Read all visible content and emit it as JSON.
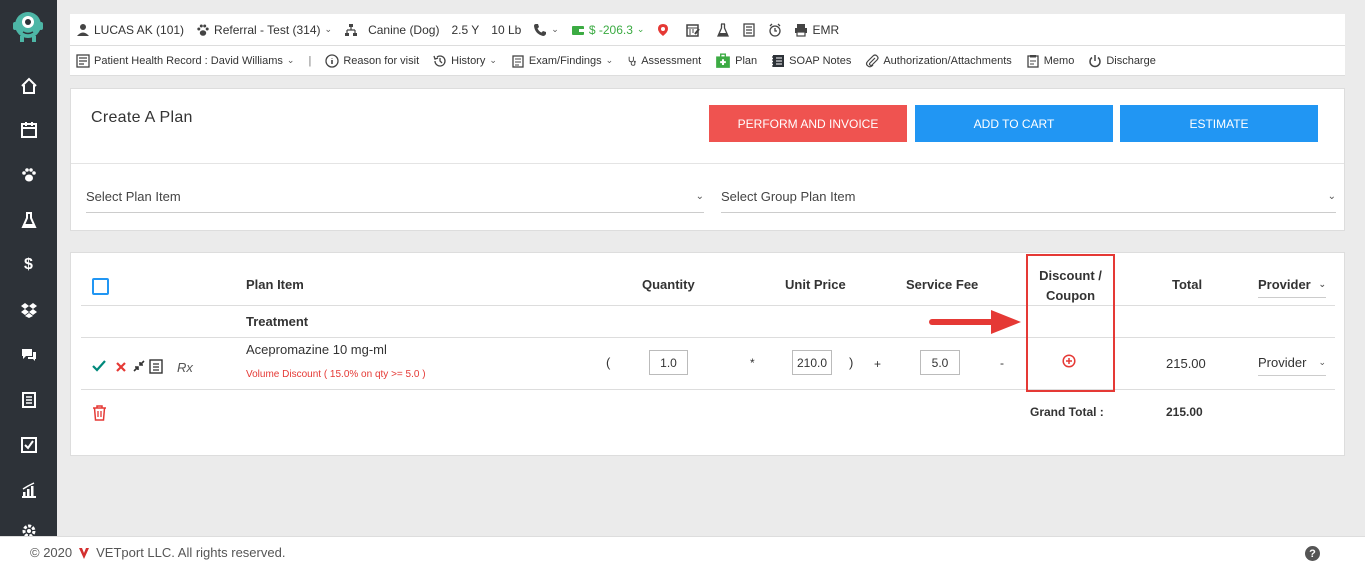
{
  "sidebar": {
    "items": [
      "home-icon",
      "calendar-icon",
      "paw-icon",
      "flask-icon",
      "dollar-icon",
      "dropbox-icon",
      "chat-icon",
      "document-icon",
      "checkbox-icon",
      "chart-icon",
      "gear-icon"
    ],
    "dollar_glyph": "$"
  },
  "header": {
    "patient_name": "LUCAS AK (101)",
    "referral": "Referral - Test (314)",
    "species": "Canine (Dog)",
    "age": "2.5 Y",
    "weight": "10 Lb",
    "balance": "$ -206.3",
    "emr": "EMR"
  },
  "nav": {
    "phr": "Patient Health Record : David Williams",
    "separator": "|",
    "reason": "Reason for visit",
    "history": "History",
    "exam": "Exam/Findings",
    "assessment": "Assessment",
    "plan": "Plan",
    "soap": "SOAP Notes",
    "authorization": "Authorization/Attachments",
    "memo": "Memo",
    "discharge": "Discharge"
  },
  "plan_panel": {
    "title": "Create A Plan",
    "btn_perform": "PERFORM AND INVOICE",
    "btn_cart": "ADD TO CART",
    "btn_estimate": "ESTIMATE",
    "select_plan_item": "Select Plan Item",
    "select_group_plan_item": "Select Group Plan Item"
  },
  "table": {
    "headers": {
      "plan_item": "Plan Item",
      "quantity": "Quantity",
      "unit_price": "Unit Price",
      "service_fee": "Service Fee",
      "discount_line1": "Discount /",
      "discount_line2": "Coupon",
      "total": "Total",
      "provider": "Provider"
    },
    "section_label": "Treatment",
    "row": {
      "rx": "Rx",
      "item_name": "Acepromazine 10 mg-ml",
      "discount_note": "Volume Discount ( 15.0% on qty >= 5.0 )",
      "open_paren": "(",
      "quantity": "1.0",
      "times": "*",
      "unit_price": "210.0",
      "close_paren": ")",
      "plus": "+",
      "service_fee": "5.0",
      "minus": "-",
      "total": "215.00",
      "provider": "Provider"
    },
    "grand_total_label": "Grand Total :",
    "grand_total": "215.00"
  },
  "footer": {
    "copyright": "© 2020",
    "company": "VETport LLC. All rights reserved.",
    "help": "?"
  },
  "colors": {
    "sidebar_bg": "#2d3238",
    "red_button": "#ef5350",
    "blue_button": "#2196f3",
    "annotation_red": "#e53935",
    "balance_green": "#3cab43"
  }
}
